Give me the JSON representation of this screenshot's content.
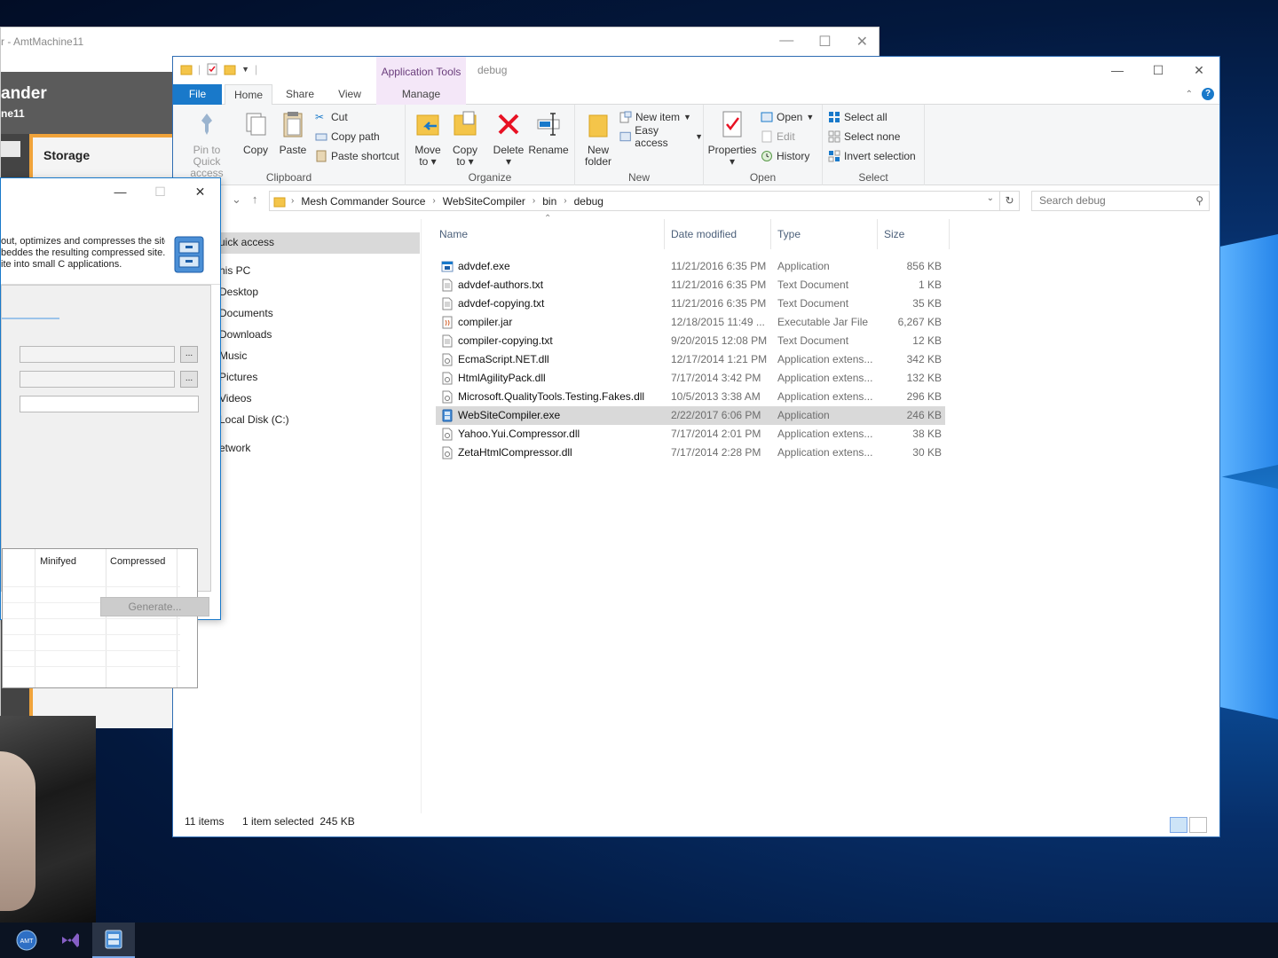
{
  "background_window": {
    "title": "r - AmtMachine11",
    "header_title": "ander",
    "header_sub": "ne11",
    "section": "Storage"
  },
  "explorer": {
    "title": "debug",
    "contextual_tab_group": "Application Tools",
    "tabs": {
      "file": "File",
      "home": "Home",
      "share": "Share",
      "view": "View",
      "manage": "Manage"
    },
    "ribbon": {
      "clipboard": {
        "label": "Clipboard",
        "pin": "Pin to Quick access",
        "pin_l1": "Pin to Quick",
        "pin_l2": "access",
        "copy": "Copy",
        "paste": "Paste",
        "cut": "Cut",
        "copy_path": "Copy path",
        "paste_shortcut": "Paste shortcut"
      },
      "organize": {
        "label": "Organize",
        "move_l1": "Move",
        "move_l2": "to",
        "copy_l1": "Copy",
        "copy_l2": "to",
        "delete": "Delete",
        "rename": "Rename"
      },
      "new": {
        "label": "New",
        "folder_l1": "New",
        "folder_l2": "folder",
        "new_item": "New item",
        "easy_access": "Easy access"
      },
      "open": {
        "label": "Open",
        "properties": "Properties",
        "open": "Open",
        "edit": "Edit",
        "history": "History"
      },
      "select": {
        "label": "Select",
        "select_all": "Select all",
        "select_none": "Select none",
        "invert": "Invert selection"
      }
    },
    "breadcrumb": [
      "Mesh Commander Source",
      "WebSiteCompiler",
      "bin",
      "debug"
    ],
    "search_placeholder": "Search debug",
    "nav": {
      "quick_access": "uick access",
      "this_pc": "his PC",
      "desktop": "Desktop",
      "documents": "Documents",
      "downloads": "Downloads",
      "music": "Music",
      "pictures": "Pictures",
      "videos": "Videos",
      "local_disk": "Local Disk (C:)",
      "network": "etwork"
    },
    "columns": {
      "name": "Name",
      "date": "Date modified",
      "type": "Type",
      "size": "Size"
    },
    "files": [
      {
        "name": "advdef.exe",
        "date": "11/21/2016 6:35 PM",
        "type": "Application",
        "size": "856 KB",
        "icon": "exe-icon"
      },
      {
        "name": "advdef-authors.txt",
        "date": "11/21/2016 6:35 PM",
        "type": "Text Document",
        "size": "1 KB",
        "icon": "text-file-icon"
      },
      {
        "name": "advdef-copying.txt",
        "date": "11/21/2016 6:35 PM",
        "type": "Text Document",
        "size": "35 KB",
        "icon": "text-file-icon"
      },
      {
        "name": "compiler.jar",
        "date": "12/18/2015 11:49 ...",
        "type": "Executable Jar File",
        "size": "6,267 KB",
        "icon": "jar-icon"
      },
      {
        "name": "compiler-copying.txt",
        "date": "9/20/2015 12:08 PM",
        "type": "Text Document",
        "size": "12 KB",
        "icon": "text-file-icon"
      },
      {
        "name": "EcmaScript.NET.dll",
        "date": "12/17/2014 1:21 PM",
        "type": "Application extens...",
        "size": "342 KB",
        "icon": "dll-icon"
      },
      {
        "name": "HtmlAgilityPack.dll",
        "date": "7/17/2014 3:42 PM",
        "type": "Application extens...",
        "size": "132 KB",
        "icon": "dll-icon"
      },
      {
        "name": "Microsoft.QualityTools.Testing.Fakes.dll",
        "date": "10/5/2013 3:38 AM",
        "type": "Application extens...",
        "size": "296 KB",
        "icon": "dll-icon"
      },
      {
        "name": "WebSiteCompiler.exe",
        "date": "2/22/2017 6:06 PM",
        "type": "Application",
        "size": "246 KB",
        "icon": "app-icon",
        "selected": true
      },
      {
        "name": "Yahoo.Yui.Compressor.dll",
        "date": "7/17/2014 2:01 PM",
        "type": "Application extens...",
        "size": "38 KB",
        "icon": "dll-icon"
      },
      {
        "name": "ZetaHtmlCompressor.dll",
        "date": "7/17/2014 2:28 PM",
        "type": "Application extens...",
        "size": "30 KB",
        "icon": "dll-icon"
      }
    ],
    "status": {
      "count": "11 items",
      "selection": "1 item selected  245 KB"
    }
  },
  "dialog": {
    "description_lines": [
      "out, optimizes and compresses the site",
      "beddes the resulting compressed site.",
      "ite into small C applications."
    ],
    "browse": "...",
    "grid_cols": {
      "minified": "Minifyed",
      "compressed": "Compressed"
    },
    "generate": "Generate..."
  },
  "colors": {
    "accent": "#1979ca",
    "manage_tab": "#f4e7f8",
    "selection": "#d9d9d9",
    "delete_red": "#e81123",
    "folder_yellow": "#f4c54a"
  }
}
